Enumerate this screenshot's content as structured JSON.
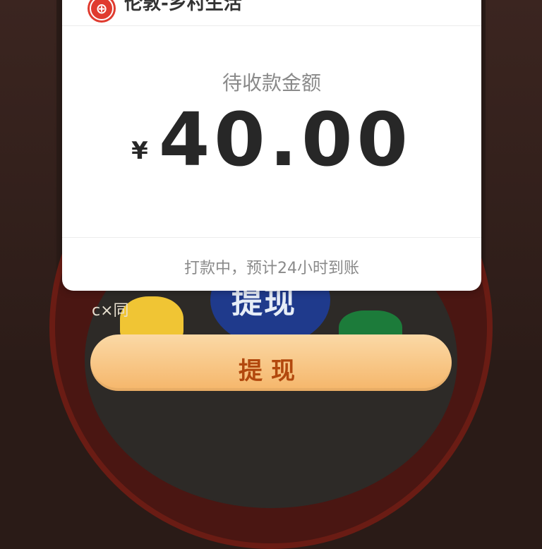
{
  "card": {
    "header_text": "伦敦-乡村生活",
    "label": "待收款金额",
    "currency": "¥",
    "amount": "40.00",
    "status": "打款中，预计24小时到账"
  },
  "background": {
    "blue_text": "提现",
    "doodle": "c×同",
    "button_label": "提现"
  },
  "colors": {
    "background": "#2a1b17",
    "red_ring": "#6a1c14",
    "card": "#ffffff",
    "accent_orange": "#f5b66a",
    "blue": "#1f3a8c",
    "logo_red": "#e03b2f"
  },
  "icons": {
    "logo": "bank-logo-icon"
  }
}
